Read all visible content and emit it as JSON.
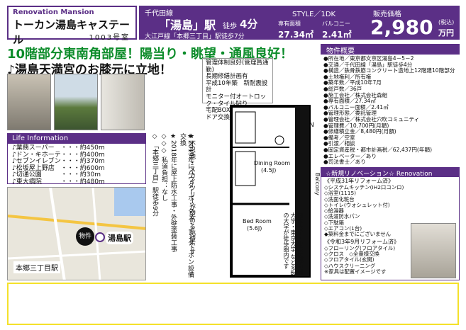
{
  "header": {
    "brand": "Renovation Mansion",
    "property_name": "トーカン湯島キャステール",
    "room": "1003号室",
    "line": "千代田線",
    "station": "「湯島」駅",
    "walk_label": "徒歩",
    "walk_min": "4分",
    "sub_access": "大江戸線「本郷三丁目」駅徒歩7分",
    "style_label": "STYLE／1DK",
    "area_label": "専有面積",
    "area_value": "27.34㎡",
    "balcony_label": "バルコニー",
    "balcony_value": "2.41㎡",
    "price_label": "販売価格",
    "price_value": "2,980",
    "price_tax": "(税込)",
    "price_unit": "万円"
  },
  "headline": {
    "line1": "10階部分東南角部屋！陽当り・眺望・通風良好！",
    "line2": "♪湯島天満宮のお膝元に立地！"
  },
  "life": {
    "title": "Life Information",
    "items": [
      "♪業務スーパー　・・・約450m",
      "♪ドン・キホーテ・・・約400m",
      "♪セブンイレブン・・・約370m",
      "♪松坂屋上野店　・・・約600m",
      "♪切通公園　　　・・・約30m",
      "♪東大病院　　　・・・約480m"
    ]
  },
  "map": {
    "label_bukken": "物件",
    "label_yushima": "湯島駅",
    "label_hongo": "本郷三丁目駅"
  },
  "features": [
    "管理体制良好(管理員通勤)",
    "長期修繕計画有",
    "平成10年築　新耐震設計",
    "モニター付オートロック・タイル貼り",
    "宅配BOX完備　■ 玄関ドア交換済"
  ],
  "vertical_notes": {
    "col1": "★不忍池・スカイツリーが望める眺望です",
    "col2": "★2019年にパウダーボックス・インターホン設備交換",
    "col3": "★2018年に屋上防水工事・外壁塗装工事",
    "col4": "◇◇◇ 私道負担：なし",
    "col5": "◇ 「本郷三丁目」駅徒歩9分"
  },
  "plan": {
    "dining": "Dining Room",
    "dining_size": "(4.5J)",
    "bed": "Bed Room",
    "bed_size": "(5.6J)",
    "balcony": "Balcony",
    "north": "N"
  },
  "school_note": "日本大学・東京医科歯科大学・東京大学 など多数の大学が徒歩圏内です",
  "gaiyo": {
    "title": "物件概要",
    "items": [
      "●所在地／東京都文京区湯島4－5－2",
      "●交通／千代田線「湯島」駅徒歩4分",
      "●構造／鉄骨鉄筋コンクリート造地上12階建10階部分",
      "●土地権利／所有権",
      "●築年数／平成10年7月",
      "●総戸数／36戸",
      "●施工会社／株式会社森組",
      "●専有面積／27.34㎡",
      "●バルコニー面積／2.41㎡",
      "●管理形態／委託管理",
      "●管理会社／株式会社穴吹コミュニティ",
      "●管理費／10,700円(月額)",
      "●修繕積立金／8,480円(月額)",
      "●備考／空室",
      "●引渡／相談",
      "●固定資産税・都市計画税／62,437円(年額)",
      "●エレベーター／あり",
      "●司法書士／あり"
    ]
  },
  "reno": {
    "title": "☆新規リノベーション☆ Renovation",
    "h1": "《平成31年リフォーム済》",
    "items1": [
      "◇システムキッチン(IH2口コンロ)",
      "◇浴室(1115)",
      "◇洗面化粧台",
      "◇トイレ(ウォシュレット付)",
      "◇給湯器",
      "◇洗濯防水パン",
      "◇下駄箱",
      "◇エアコン(1台)",
      "◆築料金までにございません"
    ],
    "h2": "《令和3年9月リフォーム済》",
    "items2": [
      "◇フローリング(フロアタイル)",
      "◇クロス　◇全量様交換",
      "◇フロアタイル(玄関)",
      "◇ハウスクリーニング",
      "※家具は配置イメージです"
    ]
  },
  "colors": {
    "accent": "#5b2f86",
    "headline_green": "#0c8c2a",
    "footer_border": "#f4e12b"
  }
}
